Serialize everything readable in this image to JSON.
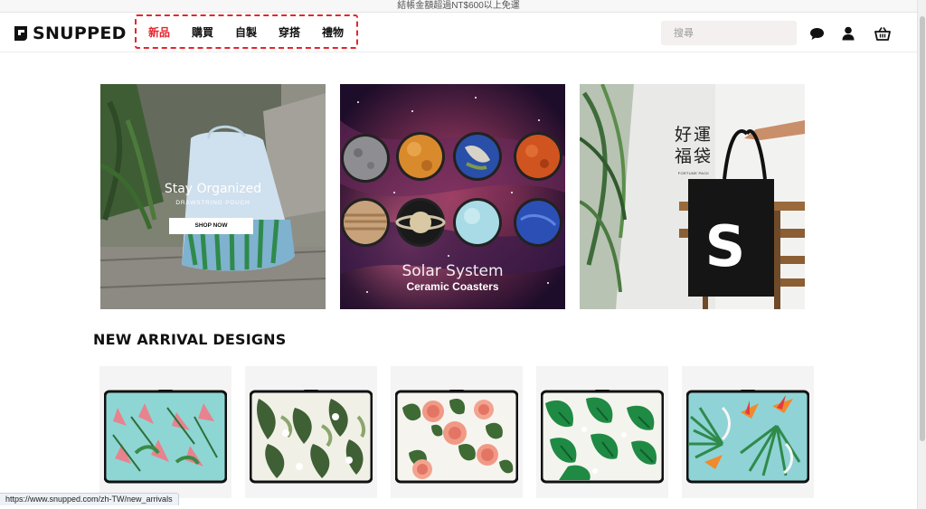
{
  "promo_bar": {
    "text": "結帳金額超過NT$600以上免運"
  },
  "header": {
    "logo_text": "SNUPPED",
    "nav": [
      {
        "label": "新品",
        "active": true
      },
      {
        "label": "購買",
        "active": false
      },
      {
        "label": "自製",
        "active": false
      },
      {
        "label": "穿搭",
        "active": false
      },
      {
        "label": "禮物",
        "active": false
      }
    ],
    "search_placeholder": "搜尋",
    "icons": [
      "chat-icon",
      "user-icon",
      "cart-icon"
    ]
  },
  "banners": [
    {
      "title": "Stay Organized",
      "subtitle": "DRAWSTRING POUCH",
      "button": "SHOP NOW"
    },
    {
      "title": "Solar System",
      "subtitle": "Ceramic Coasters"
    },
    {
      "title": "好運福袋",
      "subtitle": "FORTUNE PACK",
      "bag_letter": "S"
    }
  ],
  "section": {
    "title": "NEW ARRIVAL DESIGNS"
  },
  "products": [
    {
      "pattern": "pink lilies on aqua"
    },
    {
      "pattern": "white flowers and green leaves"
    },
    {
      "pattern": "peach roses and leaves"
    },
    {
      "pattern": "tropical green leaves"
    },
    {
      "pattern": "bird of paradise on aqua"
    }
  ],
  "status_bar": {
    "url": "https://www.snupped.com/zh-TW/new_arrivals"
  },
  "colors": {
    "accent": "#e4262d",
    "text": "#111111",
    "search_bg": "#f3f0ef",
    "tile_bg": "#f4f4f4"
  }
}
